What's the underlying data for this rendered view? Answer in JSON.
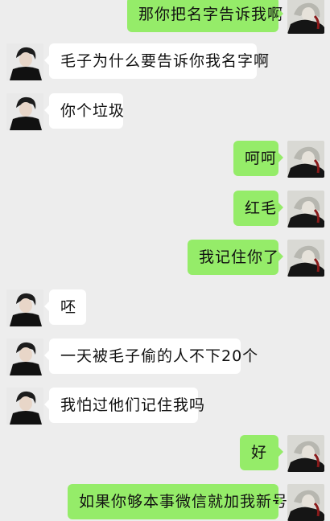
{
  "colors": {
    "background": "#ededed",
    "self_bubble": "#95ec69",
    "other_bubble": "#ffffff"
  },
  "avatars": {
    "other": "dark-haired-person-avatar",
    "self": "silver-haired-character-avatar"
  },
  "messages": [
    {
      "sender": "self",
      "text": "那你把名字告诉我啊"
    },
    {
      "sender": "other",
      "text": "毛子为什么要告诉你我名字啊"
    },
    {
      "sender": "other",
      "text": "你个垃圾"
    },
    {
      "sender": "self",
      "text": "呵呵"
    },
    {
      "sender": "self",
      "text": "红毛"
    },
    {
      "sender": "self",
      "text": "我记住你了"
    },
    {
      "sender": "other",
      "text": "呸"
    },
    {
      "sender": "other",
      "text": "一天被毛子偷的人不下20个"
    },
    {
      "sender": "other",
      "text": "我怕过他们记住我吗"
    },
    {
      "sender": "self",
      "text": "好"
    },
    {
      "sender": "self",
      "text": "如果你够本事微信就加我新号"
    }
  ]
}
